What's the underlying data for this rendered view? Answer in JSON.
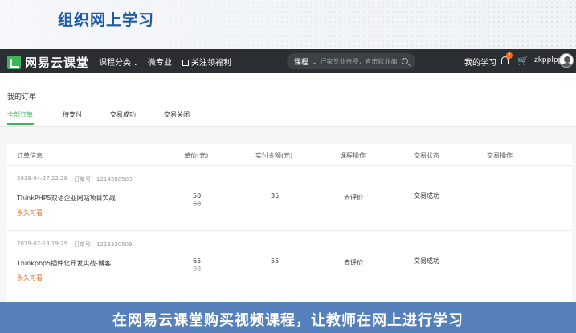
{
  "banner": {
    "title": "组织网上学习"
  },
  "nav": {
    "brand": "网易云课堂",
    "course_category": "课程分类",
    "micro_major": "微专业",
    "follow_benefit": "关注领福利",
    "search_scope": "课程",
    "search_placeholder": "行家专业亲授，直击就业痛",
    "my_study": "我的学习",
    "notification_count": "1",
    "username": "zkpplpp"
  },
  "orders": {
    "title": "我的订单",
    "tabs": [
      {
        "label": "全部订单",
        "active": true
      },
      {
        "label": "待支付",
        "active": false
      },
      {
        "label": "交易成功",
        "active": false
      },
      {
        "label": "交易关闭",
        "active": false
      }
    ],
    "columns": [
      "订单信息",
      "单价(元)",
      "实付金额(元)",
      "课程操作",
      "交易状态",
      "交易操作"
    ],
    "rows": [
      {
        "date": "2019-04-27 22:28",
        "order_no_label": "订单号：",
        "order_no": "1214288583",
        "course": "ThinkPHP5双语企业网站项目实战",
        "validity": "永久可看",
        "price": "50",
        "original_price": "68",
        "paid": "35",
        "action": "去评价",
        "status": "交易成功"
      },
      {
        "date": "2019-02-13 19:29",
        "order_no_label": "订单号：",
        "order_no": "1213330509",
        "course": "Thinkphp5插件化开发实战-博客",
        "validity": "永久可看",
        "price": "65",
        "original_price": "98",
        "paid": "55",
        "action": "去评价",
        "status": "交易成功"
      }
    ]
  },
  "caption": {
    "text": "在网易云课堂购买视频课程，让教师在网上进行学习"
  },
  "colors": {
    "brand_green": "#3fb55b",
    "nav_bg": "#2b2f33",
    "accent_orange": "#e9661a",
    "caption_bg": "#5680b9",
    "title_blue": "#1f5aa6"
  }
}
